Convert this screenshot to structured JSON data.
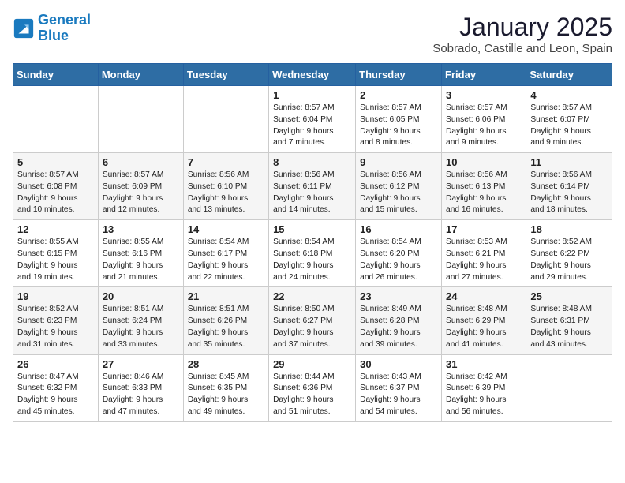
{
  "logo": {
    "line1": "General",
    "line2": "Blue"
  },
  "title": "January 2025",
  "location": "Sobrado, Castille and Leon, Spain",
  "days_of_week": [
    "Sunday",
    "Monday",
    "Tuesday",
    "Wednesday",
    "Thursday",
    "Friday",
    "Saturday"
  ],
  "weeks": [
    [
      {
        "day": "",
        "info": ""
      },
      {
        "day": "",
        "info": ""
      },
      {
        "day": "",
        "info": ""
      },
      {
        "day": "1",
        "info": "Sunrise: 8:57 AM\nSunset: 6:04 PM\nDaylight: 9 hours\nand 7 minutes."
      },
      {
        "day": "2",
        "info": "Sunrise: 8:57 AM\nSunset: 6:05 PM\nDaylight: 9 hours\nand 8 minutes."
      },
      {
        "day": "3",
        "info": "Sunrise: 8:57 AM\nSunset: 6:06 PM\nDaylight: 9 hours\nand 9 minutes."
      },
      {
        "day": "4",
        "info": "Sunrise: 8:57 AM\nSunset: 6:07 PM\nDaylight: 9 hours\nand 9 minutes."
      }
    ],
    [
      {
        "day": "5",
        "info": "Sunrise: 8:57 AM\nSunset: 6:08 PM\nDaylight: 9 hours\nand 10 minutes."
      },
      {
        "day": "6",
        "info": "Sunrise: 8:57 AM\nSunset: 6:09 PM\nDaylight: 9 hours\nand 12 minutes."
      },
      {
        "day": "7",
        "info": "Sunrise: 8:56 AM\nSunset: 6:10 PM\nDaylight: 9 hours\nand 13 minutes."
      },
      {
        "day": "8",
        "info": "Sunrise: 8:56 AM\nSunset: 6:11 PM\nDaylight: 9 hours\nand 14 minutes."
      },
      {
        "day": "9",
        "info": "Sunrise: 8:56 AM\nSunset: 6:12 PM\nDaylight: 9 hours\nand 15 minutes."
      },
      {
        "day": "10",
        "info": "Sunrise: 8:56 AM\nSunset: 6:13 PM\nDaylight: 9 hours\nand 16 minutes."
      },
      {
        "day": "11",
        "info": "Sunrise: 8:56 AM\nSunset: 6:14 PM\nDaylight: 9 hours\nand 18 minutes."
      }
    ],
    [
      {
        "day": "12",
        "info": "Sunrise: 8:55 AM\nSunset: 6:15 PM\nDaylight: 9 hours\nand 19 minutes."
      },
      {
        "day": "13",
        "info": "Sunrise: 8:55 AM\nSunset: 6:16 PM\nDaylight: 9 hours\nand 21 minutes."
      },
      {
        "day": "14",
        "info": "Sunrise: 8:54 AM\nSunset: 6:17 PM\nDaylight: 9 hours\nand 22 minutes."
      },
      {
        "day": "15",
        "info": "Sunrise: 8:54 AM\nSunset: 6:18 PM\nDaylight: 9 hours\nand 24 minutes."
      },
      {
        "day": "16",
        "info": "Sunrise: 8:54 AM\nSunset: 6:20 PM\nDaylight: 9 hours\nand 26 minutes."
      },
      {
        "day": "17",
        "info": "Sunrise: 8:53 AM\nSunset: 6:21 PM\nDaylight: 9 hours\nand 27 minutes."
      },
      {
        "day": "18",
        "info": "Sunrise: 8:52 AM\nSunset: 6:22 PM\nDaylight: 9 hours\nand 29 minutes."
      }
    ],
    [
      {
        "day": "19",
        "info": "Sunrise: 8:52 AM\nSunset: 6:23 PM\nDaylight: 9 hours\nand 31 minutes."
      },
      {
        "day": "20",
        "info": "Sunrise: 8:51 AM\nSunset: 6:24 PM\nDaylight: 9 hours\nand 33 minutes."
      },
      {
        "day": "21",
        "info": "Sunrise: 8:51 AM\nSunset: 6:26 PM\nDaylight: 9 hours\nand 35 minutes."
      },
      {
        "day": "22",
        "info": "Sunrise: 8:50 AM\nSunset: 6:27 PM\nDaylight: 9 hours\nand 37 minutes."
      },
      {
        "day": "23",
        "info": "Sunrise: 8:49 AM\nSunset: 6:28 PM\nDaylight: 9 hours\nand 39 minutes."
      },
      {
        "day": "24",
        "info": "Sunrise: 8:48 AM\nSunset: 6:29 PM\nDaylight: 9 hours\nand 41 minutes."
      },
      {
        "day": "25",
        "info": "Sunrise: 8:48 AM\nSunset: 6:31 PM\nDaylight: 9 hours\nand 43 minutes."
      }
    ],
    [
      {
        "day": "26",
        "info": "Sunrise: 8:47 AM\nSunset: 6:32 PM\nDaylight: 9 hours\nand 45 minutes."
      },
      {
        "day": "27",
        "info": "Sunrise: 8:46 AM\nSunset: 6:33 PM\nDaylight: 9 hours\nand 47 minutes."
      },
      {
        "day": "28",
        "info": "Sunrise: 8:45 AM\nSunset: 6:35 PM\nDaylight: 9 hours\nand 49 minutes."
      },
      {
        "day": "29",
        "info": "Sunrise: 8:44 AM\nSunset: 6:36 PM\nDaylight: 9 hours\nand 51 minutes."
      },
      {
        "day": "30",
        "info": "Sunrise: 8:43 AM\nSunset: 6:37 PM\nDaylight: 9 hours\nand 54 minutes."
      },
      {
        "day": "31",
        "info": "Sunrise: 8:42 AM\nSunset: 6:39 PM\nDaylight: 9 hours\nand 56 minutes."
      },
      {
        "day": "",
        "info": ""
      }
    ]
  ]
}
